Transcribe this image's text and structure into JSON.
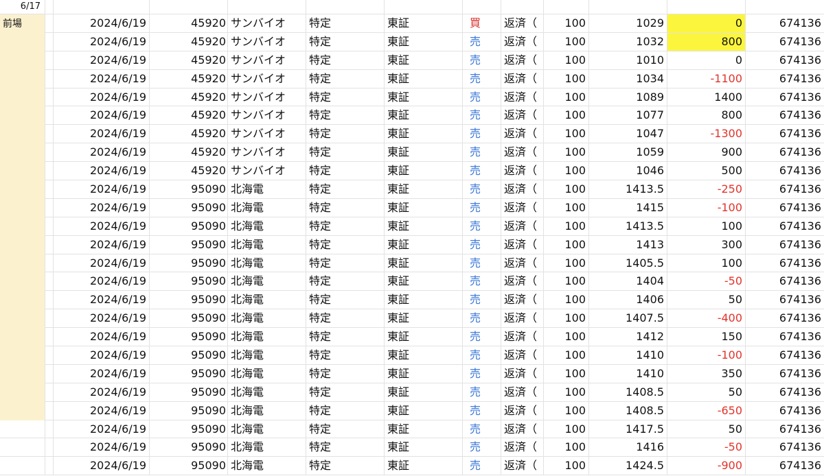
{
  "header_date": "6/17",
  "side_label": "前場",
  "rows": [
    {
      "date": "2024/6/19",
      "code": "45920",
      "name": "サンバイオ",
      "account": "特定",
      "market": "東証",
      "side": "買",
      "side_type": "buy",
      "trade": "返済（",
      "qty": "100",
      "price": "1029",
      "pnl": "0",
      "pnl_neg": false,
      "highlight": true,
      "total": "674136"
    },
    {
      "date": "2024/6/19",
      "code": "45920",
      "name": "サンバイオ",
      "account": "特定",
      "market": "東証",
      "side": "売",
      "side_type": "sell",
      "trade": "返済（",
      "qty": "100",
      "price": "1032",
      "pnl": "800",
      "pnl_neg": false,
      "highlight": true,
      "total": "674136"
    },
    {
      "date": "2024/6/19",
      "code": "45920",
      "name": "サンバイオ",
      "account": "特定",
      "market": "東証",
      "side": "売",
      "side_type": "sell",
      "trade": "返済（",
      "qty": "100",
      "price": "1010",
      "pnl": "0",
      "pnl_neg": false,
      "highlight": false,
      "total": "674136"
    },
    {
      "date": "2024/6/19",
      "code": "45920",
      "name": "サンバイオ",
      "account": "特定",
      "market": "東証",
      "side": "売",
      "side_type": "sell",
      "trade": "返済（",
      "qty": "100",
      "price": "1034",
      "pnl": "-1100",
      "pnl_neg": true,
      "highlight": false,
      "total": "674136"
    },
    {
      "date": "2024/6/19",
      "code": "45920",
      "name": "サンバイオ",
      "account": "特定",
      "market": "東証",
      "side": "売",
      "side_type": "sell",
      "trade": "返済（",
      "qty": "100",
      "price": "1089",
      "pnl": "1400",
      "pnl_neg": false,
      "highlight": false,
      "total": "674136"
    },
    {
      "date": "2024/6/19",
      "code": "45920",
      "name": "サンバイオ",
      "account": "特定",
      "market": "東証",
      "side": "売",
      "side_type": "sell",
      "trade": "返済（",
      "qty": "100",
      "price": "1077",
      "pnl": "800",
      "pnl_neg": false,
      "highlight": false,
      "total": "674136"
    },
    {
      "date": "2024/6/19",
      "code": "45920",
      "name": "サンバイオ",
      "account": "特定",
      "market": "東証",
      "side": "売",
      "side_type": "sell",
      "trade": "返済（",
      "qty": "100",
      "price": "1047",
      "pnl": "-1300",
      "pnl_neg": true,
      "highlight": false,
      "total": "674136"
    },
    {
      "date": "2024/6/19",
      "code": "45920",
      "name": "サンバイオ",
      "account": "特定",
      "market": "東証",
      "side": "売",
      "side_type": "sell",
      "trade": "返済（",
      "qty": "100",
      "price": "1059",
      "pnl": "900",
      "pnl_neg": false,
      "highlight": false,
      "total": "674136"
    },
    {
      "date": "2024/6/19",
      "code": "45920",
      "name": "サンバイオ",
      "account": "特定",
      "market": "東証",
      "side": "売",
      "side_type": "sell",
      "trade": "返済（",
      "qty": "100",
      "price": "1046",
      "pnl": "500",
      "pnl_neg": false,
      "highlight": false,
      "total": "674136"
    },
    {
      "date": "2024/6/19",
      "code": "95090",
      "name": "北海電",
      "account": "特定",
      "market": "東証",
      "side": "売",
      "side_type": "sell",
      "trade": "返済（",
      "qty": "100",
      "price": "1413.5",
      "pnl": "-250",
      "pnl_neg": true,
      "highlight": false,
      "total": "674136"
    },
    {
      "date": "2024/6/19",
      "code": "95090",
      "name": "北海電",
      "account": "特定",
      "market": "東証",
      "side": "売",
      "side_type": "sell",
      "trade": "返済（",
      "qty": "100",
      "price": "1415",
      "pnl": "-100",
      "pnl_neg": true,
      "highlight": false,
      "total": "674136"
    },
    {
      "date": "2024/6/19",
      "code": "95090",
      "name": "北海電",
      "account": "特定",
      "market": "東証",
      "side": "売",
      "side_type": "sell",
      "trade": "返済（",
      "qty": "100",
      "price": "1413.5",
      "pnl": "100",
      "pnl_neg": false,
      "highlight": false,
      "total": "674136"
    },
    {
      "date": "2024/6/19",
      "code": "95090",
      "name": "北海電",
      "account": "特定",
      "market": "東証",
      "side": "売",
      "side_type": "sell",
      "trade": "返済（",
      "qty": "100",
      "price": "1413",
      "pnl": "300",
      "pnl_neg": false,
      "highlight": false,
      "total": "674136"
    },
    {
      "date": "2024/6/19",
      "code": "95090",
      "name": "北海電",
      "account": "特定",
      "market": "東証",
      "side": "売",
      "side_type": "sell",
      "trade": "返済（",
      "qty": "100",
      "price": "1405.5",
      "pnl": "100",
      "pnl_neg": false,
      "highlight": false,
      "total": "674136"
    },
    {
      "date": "2024/6/19",
      "code": "95090",
      "name": "北海電",
      "account": "特定",
      "market": "東証",
      "side": "売",
      "side_type": "sell",
      "trade": "返済（",
      "qty": "100",
      "price": "1404",
      "pnl": "-50",
      "pnl_neg": true,
      "highlight": false,
      "total": "674136"
    },
    {
      "date": "2024/6/19",
      "code": "95090",
      "name": "北海電",
      "account": "特定",
      "market": "東証",
      "side": "売",
      "side_type": "sell",
      "trade": "返済（",
      "qty": "100",
      "price": "1406",
      "pnl": "50",
      "pnl_neg": false,
      "highlight": false,
      "total": "674136"
    },
    {
      "date": "2024/6/19",
      "code": "95090",
      "name": "北海電",
      "account": "特定",
      "market": "東証",
      "side": "売",
      "side_type": "sell",
      "trade": "返済（",
      "qty": "100",
      "price": "1407.5",
      "pnl": "-400",
      "pnl_neg": true,
      "highlight": false,
      "total": "674136"
    },
    {
      "date": "2024/6/19",
      "code": "95090",
      "name": "北海電",
      "account": "特定",
      "market": "東証",
      "side": "売",
      "side_type": "sell",
      "trade": "返済（",
      "qty": "100",
      "price": "1412",
      "pnl": "150",
      "pnl_neg": false,
      "highlight": false,
      "total": "674136"
    },
    {
      "date": "2024/6/19",
      "code": "95090",
      "name": "北海電",
      "account": "特定",
      "market": "東証",
      "side": "売",
      "side_type": "sell",
      "trade": "返済（",
      "qty": "100",
      "price": "1410",
      "pnl": "-100",
      "pnl_neg": true,
      "highlight": false,
      "total": "674136"
    },
    {
      "date": "2024/6/19",
      "code": "95090",
      "name": "北海電",
      "account": "特定",
      "market": "東証",
      "side": "売",
      "side_type": "sell",
      "trade": "返済（",
      "qty": "100",
      "price": "1410",
      "pnl": "350",
      "pnl_neg": false,
      "highlight": false,
      "total": "674136"
    },
    {
      "date": "2024/6/19",
      "code": "95090",
      "name": "北海電",
      "account": "特定",
      "market": "東証",
      "side": "売",
      "side_type": "sell",
      "trade": "返済（",
      "qty": "100",
      "price": "1408.5",
      "pnl": "50",
      "pnl_neg": false,
      "highlight": false,
      "total": "674136"
    },
    {
      "date": "2024/6/19",
      "code": "95090",
      "name": "北海電",
      "account": "特定",
      "market": "東証",
      "side": "売",
      "side_type": "sell",
      "trade": "返済（",
      "qty": "100",
      "price": "1408.5",
      "pnl": "-650",
      "pnl_neg": true,
      "highlight": false,
      "total": "674136"
    },
    {
      "date": "2024/6/19",
      "code": "95090",
      "name": "北海電",
      "account": "特定",
      "market": "東証",
      "side": "売",
      "side_type": "sell",
      "trade": "返済（",
      "qty": "100",
      "price": "1417.5",
      "pnl": "50",
      "pnl_neg": false,
      "highlight": false,
      "total": "674136"
    },
    {
      "date": "2024/6/19",
      "code": "95090",
      "name": "北海電",
      "account": "特定",
      "market": "東証",
      "side": "売",
      "side_type": "sell",
      "trade": "返済（",
      "qty": "100",
      "price": "1416",
      "pnl": "-50",
      "pnl_neg": true,
      "highlight": false,
      "total": "674136"
    },
    {
      "date": "2024/6/19",
      "code": "95090",
      "name": "北海電",
      "account": "特定",
      "market": "東証",
      "side": "売",
      "side_type": "sell",
      "trade": "返済（",
      "qty": "100",
      "price": "1424.5",
      "pnl": "-900",
      "pnl_neg": true,
      "highlight": false,
      "total": "674136"
    }
  ],
  "side_band_rows": 22
}
